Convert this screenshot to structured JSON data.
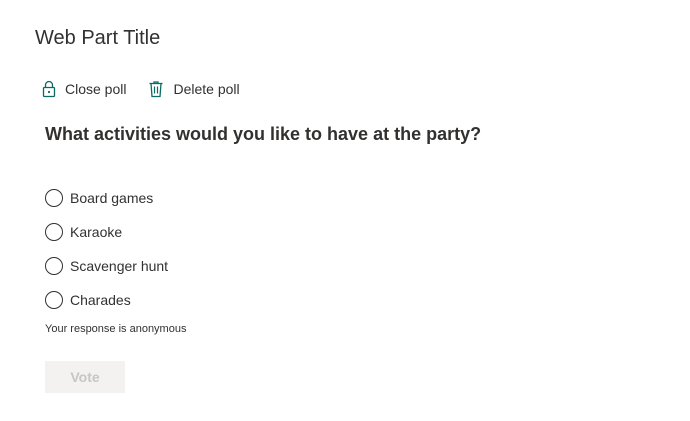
{
  "webpart": {
    "title": "Web Part Title"
  },
  "toolbar": {
    "close_poll_label": "Close poll",
    "close_poll_icon": "lock-icon",
    "delete_poll_label": "Delete poll",
    "delete_poll_icon": "trash-icon",
    "icon_color": "#0b6a61"
  },
  "poll": {
    "question": "What activities would you like to have at the party?",
    "options": [
      {
        "label": "Board games",
        "selected": false
      },
      {
        "label": "Karaoke",
        "selected": false
      },
      {
        "label": "Scavenger hunt",
        "selected": false
      },
      {
        "label": "Charades",
        "selected": false
      }
    ],
    "anonymous_note": "Your response is anonymous",
    "vote_label": "Vote",
    "vote_enabled": false
  }
}
